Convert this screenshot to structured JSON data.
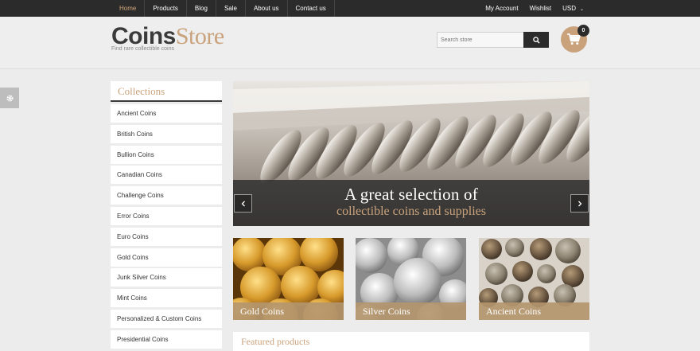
{
  "topnav": {
    "items": [
      "Home",
      "Products",
      "Blog",
      "Sale",
      "About us",
      "Contact us"
    ]
  },
  "toplinks": {
    "account": "My Account",
    "wishlist": "Wishlist",
    "currency": "USD"
  },
  "header": {
    "logo_bold": "Coins",
    "logo_light": "Store",
    "tagline": "Find rare collectible coins",
    "search_placeholder": "Search store",
    "cart_count": "0"
  },
  "sidebar": {
    "title": "Collections",
    "items": [
      "Ancient Coins",
      "British Coins",
      "Bullion Coins",
      "Canadian Coins",
      "Challenge Coins",
      "Error Coins",
      "Euro Coins",
      "Gold Coins",
      "Junk Silver Coins",
      "Mint Coins",
      "Personalized & Custom Coins",
      "Presidential Coins"
    ]
  },
  "slider": {
    "caption_line1": "A great selection of",
    "caption_line2": "collectible coins and supplies"
  },
  "banners": [
    "Gold Coins",
    "Silver Coins",
    "Ancient Coins"
  ],
  "featured": {
    "title": "Featured products"
  },
  "colors": {
    "accent": "#c9a27c",
    "dark": "#2b2b2b",
    "background": "#ececec"
  }
}
